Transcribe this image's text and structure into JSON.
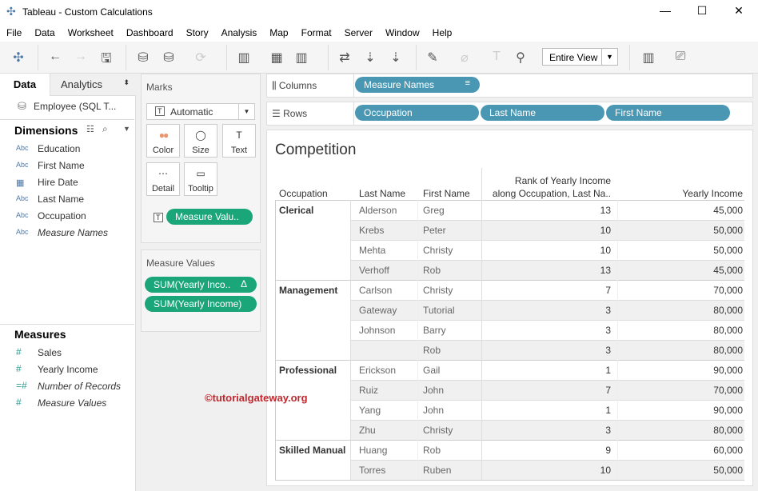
{
  "window": {
    "title": "Tableau - Custom Calculations",
    "minimize": "—",
    "maximize": "☐",
    "close": "✕"
  },
  "menu": [
    "File",
    "Data",
    "Worksheet",
    "Dashboard",
    "Story",
    "Analysis",
    "Map",
    "Format",
    "Server",
    "Window",
    "Help"
  ],
  "toolbar": {
    "fit_select": "Entire View"
  },
  "left": {
    "tab_data": "Data",
    "tab_analytics": "Analytics",
    "datasource": "Employee (SQL T...",
    "dimensions_title": "Dimensions",
    "measures_title": "Measures",
    "dimensions": [
      {
        "type": "Abc",
        "label": "Education"
      },
      {
        "type": "Abc",
        "label": "First Name"
      },
      {
        "type": "date",
        "label": "Hire Date"
      },
      {
        "type": "Abc",
        "label": "Last Name"
      },
      {
        "type": "Abc",
        "label": "Occupation"
      },
      {
        "type": "Abc",
        "label": "Measure Names",
        "italic": true
      }
    ],
    "measures": [
      {
        "label": "Sales"
      },
      {
        "label": "Yearly Income"
      },
      {
        "label": "Number of Records",
        "italic": true
      },
      {
        "label": "Measure Values",
        "italic": true
      }
    ]
  },
  "marks": {
    "title": "Marks",
    "type": "Automatic",
    "cards": [
      "Color",
      "Size",
      "Text",
      "Detail",
      "Tooltip"
    ],
    "text_pill": "Measure Valu.."
  },
  "measure_values": {
    "title": "Measure Values",
    "pills": [
      "SUM(Yearly Inco..",
      "SUM(Yearly Income)"
    ],
    "delta": "Δ"
  },
  "shelves": {
    "columns_label": "Columns",
    "rows_label": "Rows",
    "columns": [
      "Measure Names"
    ],
    "rows": [
      "Occupation",
      "Last Name",
      "First Name"
    ]
  },
  "colors": {
    "green_pill": "#1ba67a",
    "blue_pill": "#4a97b4",
    "watermark": "#c0282d"
  },
  "viz": {
    "title": "Competition",
    "headers": {
      "occupation": "Occupation",
      "last": "Last Name",
      "first": "First Name",
      "rank1": "Rank of Yearly Income",
      "rank2": "along Occupation, Last Na..",
      "income": "Yearly Income"
    },
    "groups": [
      {
        "occupation": "Clerical",
        "rows": [
          [
            "Alderson",
            "Greg",
            "13",
            "45,000"
          ],
          [
            "Krebs",
            "Peter",
            "10",
            "50,000"
          ],
          [
            "Mehta",
            "Christy",
            "10",
            "50,000"
          ],
          [
            "Verhoff",
            "Rob",
            "13",
            "45,000"
          ]
        ]
      },
      {
        "occupation": "Management",
        "rows": [
          [
            "Carlson",
            "Christy",
            "7",
            "70,000"
          ],
          [
            "Gateway",
            "Tutorial",
            "3",
            "80,000"
          ],
          [
            "Johnson",
            "Barry",
            "3",
            "80,000"
          ],
          [
            "",
            "Rob",
            "3",
            "80,000"
          ]
        ]
      },
      {
        "occupation": "Professional",
        "rows": [
          [
            "Erickson",
            "Gail",
            "1",
            "90,000"
          ],
          [
            "Ruiz",
            "John",
            "7",
            "70,000"
          ],
          [
            "Yang",
            "John",
            "1",
            "90,000"
          ],
          [
            "Zhu",
            "Christy",
            "3",
            "80,000"
          ]
        ]
      },
      {
        "occupation": "Skilled Manual",
        "rows": [
          [
            "Huang",
            "Rob",
            "9",
            "60,000"
          ],
          [
            "Torres",
            "Ruben",
            "10",
            "50,000"
          ]
        ]
      }
    ]
  },
  "watermark": "©tutorialgateway.org"
}
